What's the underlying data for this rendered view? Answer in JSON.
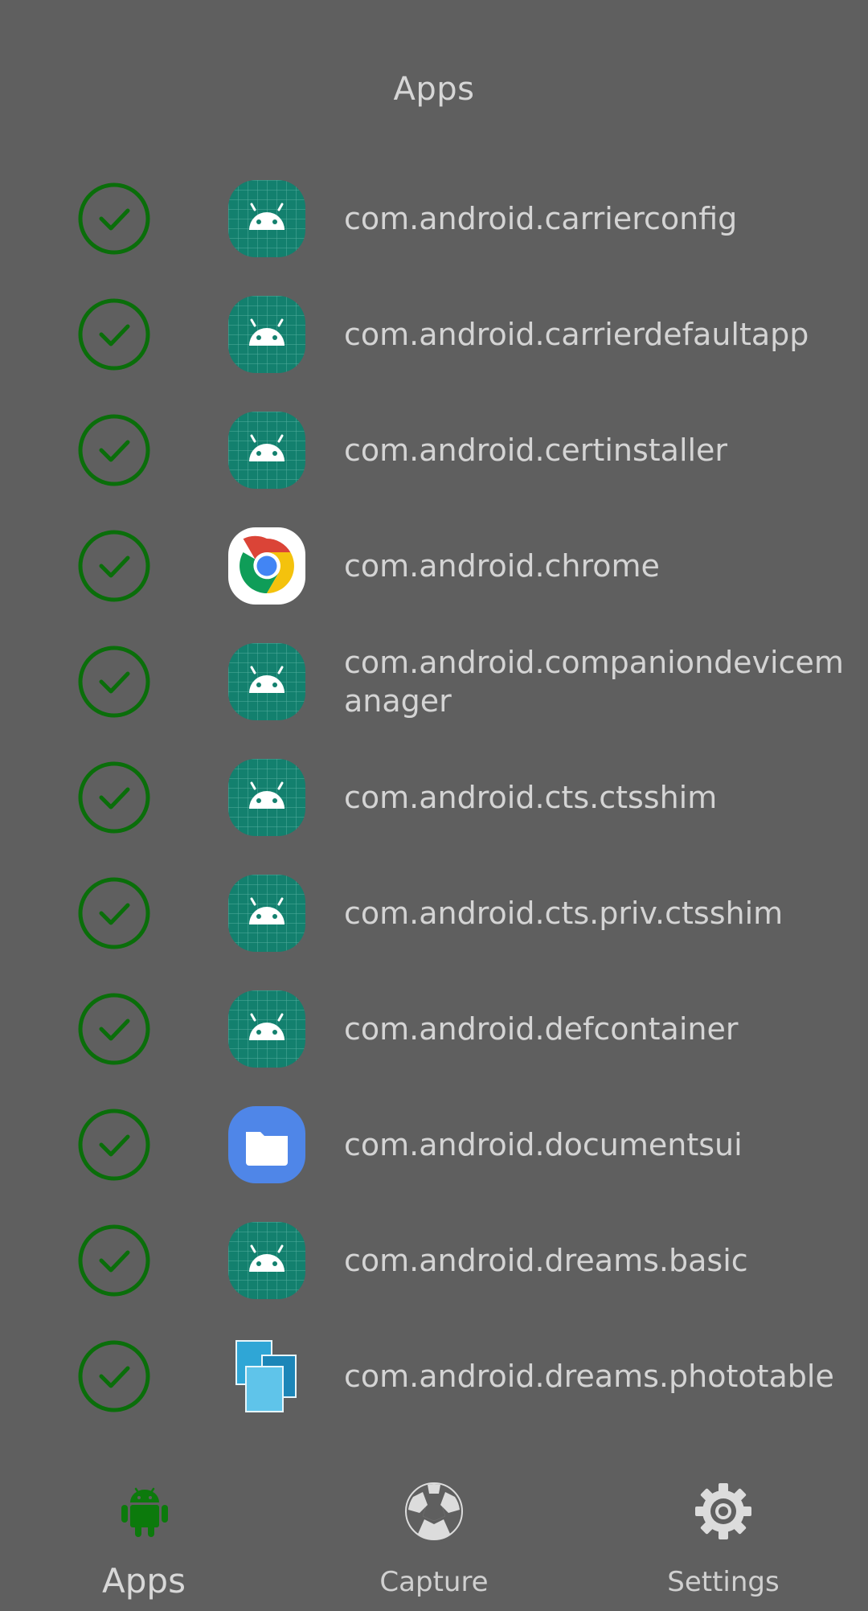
{
  "header": {
    "title": "Apps"
  },
  "apps": [
    {
      "name": "com.android.carrierconfig",
      "icon": "android-icon",
      "checked": true
    },
    {
      "name": "com.android.carrierdefaultapp",
      "icon": "android-icon",
      "checked": true
    },
    {
      "name": "com.android.certinstaller",
      "icon": "android-icon",
      "checked": true
    },
    {
      "name": "com.android.chrome",
      "icon": "chrome-icon",
      "checked": true
    },
    {
      "name": "com.android.companiondevicemanager",
      "icon": "android-icon",
      "checked": true
    },
    {
      "name": "com.android.cts.ctsshim",
      "icon": "android-icon",
      "checked": true
    },
    {
      "name": "com.android.cts.priv.ctsshim",
      "icon": "android-icon",
      "checked": true
    },
    {
      "name": "com.android.defcontainer",
      "icon": "android-icon",
      "checked": true
    },
    {
      "name": "com.android.documentsui",
      "icon": "files-folder-icon",
      "checked": true
    },
    {
      "name": "com.android.dreams.basic",
      "icon": "android-icon",
      "checked": true
    },
    {
      "name": "com.android.dreams.phototable",
      "icon": "photo-table-icon",
      "checked": true
    }
  ],
  "bottom_nav": {
    "items": [
      {
        "label": "Apps",
        "icon": "android-robot-icon",
        "active": true
      },
      {
        "label": "Capture",
        "icon": "capture-icon",
        "active": false
      },
      {
        "label": "Settings",
        "icon": "gear-icon",
        "active": false
      }
    ]
  },
  "colors": {
    "background": "#5f5f5f",
    "check_green": "#0a6e0a",
    "android_teal": "#13806e",
    "active_tab": "#0c7a0c",
    "text": "#d6d6d6"
  }
}
